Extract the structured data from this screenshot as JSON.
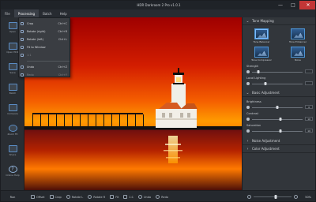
{
  "window": {
    "title": "HDR Darkroom 2 Pro v1.0.1",
    "controls": [
      "minimize",
      "maximize",
      "close"
    ]
  },
  "menu": {
    "items": [
      "File",
      "Processing",
      "Batch",
      "Help"
    ],
    "active_index": 1
  },
  "left_toolbar": {
    "items": [
      "Open",
      "Open HDR",
      "Save",
      "Batch",
      "Compare",
      "Zoom Fit",
      "Share",
      "Online Help"
    ]
  },
  "dropdown": {
    "items": [
      {
        "label": "Crop",
        "shortcut": "Ctrl+C",
        "enabled": true
      },
      {
        "label": "Rotate (right)",
        "shortcut": "Ctrl+R",
        "enabled": true
      },
      {
        "label": "Rotate (left)",
        "shortcut": "Ctrl+L",
        "enabled": true
      },
      {
        "label": "Fit to Window",
        "shortcut": "",
        "enabled": true
      },
      {
        "label": "1:1",
        "shortcut": "",
        "enabled": false
      },
      {
        "label": "Undo",
        "shortcut": "Ctrl+Z",
        "enabled": true
      },
      {
        "label": "Redo",
        "shortcut": "Ctrl+Y",
        "enabled": false
      }
    ]
  },
  "right_panel": {
    "tone_mapping": {
      "title": "Tone Mapping",
      "presets": [
        {
          "label": "Tone Balancer",
          "active": true
        },
        {
          "label": "Tone Enhancer",
          "active": false
        },
        {
          "label": "Tone Compressor",
          "active": false
        },
        {
          "label": "None",
          "active": false
        }
      ],
      "sliders": [
        {
          "label": "Strength",
          "value": "",
          "position": 0.12
        },
        {
          "label": "Local Lighting",
          "value": "",
          "position": 0.26
        }
      ]
    },
    "basic_adjustment": {
      "title": "Basic Adjustment",
      "sliders": [
        {
          "label": "Brightness",
          "value": "0",
          "position": 0.5
        },
        {
          "label": "Contrast",
          "value": "10",
          "position": 0.56
        },
        {
          "label": "Saturation",
          "value": "10",
          "position": 0.56
        }
      ]
    },
    "collapsed_sections": [
      "Noise Adjustment",
      "Color Adjustment"
    ]
  },
  "bottom_bar": {
    "left_label": "Run",
    "tools": [
      "Offset",
      "Crop",
      "Rotate L",
      "Rotate R",
      "Fit",
      "1:1",
      "Undo",
      "Redo"
    ],
    "zoom": {
      "value": "50%",
      "position": 0.58
    }
  },
  "photo": {
    "sky_colors": [
      "#b90000",
      "#f04d00",
      "#ff9300"
    ],
    "sun_color": "#fff1b0",
    "lighthouse_colors": [
      "#f2efe8",
      "#d95a1f",
      "#0b0b0b"
    ]
  }
}
